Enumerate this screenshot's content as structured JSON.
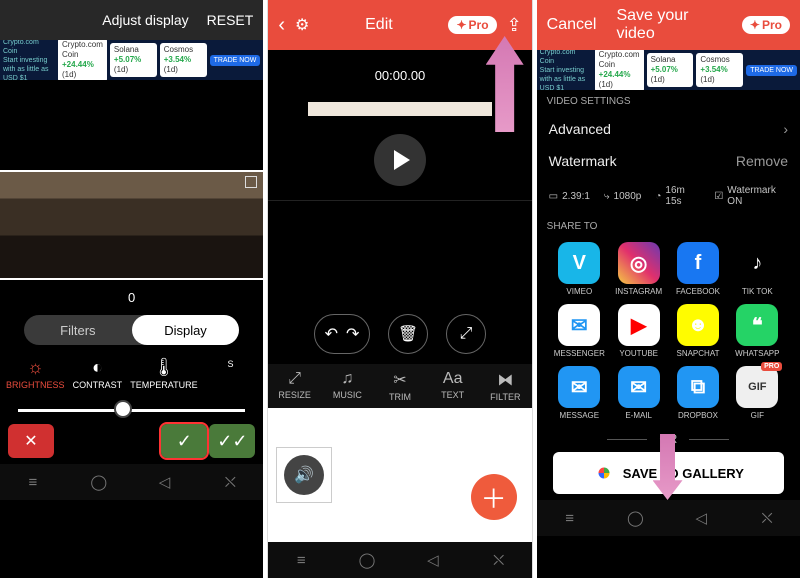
{
  "screen1": {
    "header": {
      "adjust": "Adjust display",
      "reset": "RESET"
    },
    "value": "0",
    "tabs": {
      "filters": "Filters",
      "display": "Display"
    },
    "adjustments": [
      {
        "name": "BRIGHTNESS",
        "icon": "☼"
      },
      {
        "name": "CONTRAST",
        "icon": "◐"
      },
      {
        "name": "TEMPERATURE",
        "icon": "🌡"
      },
      {
        "name": "S",
        "icon": ""
      }
    ]
  },
  "ad": {
    "tagline1": "Crypto.com Coin",
    "tagline2": "Start investing with as little as USD $1",
    "trade": "TRADE NOW",
    "cards": [
      {
        "name": "Crypto.com Coin",
        "pct": "+24.44%",
        "suffix": "(1d)"
      },
      {
        "name": "Solana",
        "pct": "+5.07%",
        "suffix": "(1d)"
      },
      {
        "name": "Cosmos",
        "pct": "+3.54%",
        "suffix": "(1d)"
      }
    ]
  },
  "screen2": {
    "title": "Edit",
    "pro": "Pro",
    "timestamp": "00:00.00",
    "tools": [
      {
        "name": "RESIZE",
        "icon": "⤢"
      },
      {
        "name": "MUSIC",
        "icon": "♫"
      },
      {
        "name": "TRIM",
        "icon": "✂"
      },
      {
        "name": "TEXT",
        "icon": "Aa"
      },
      {
        "name": "FILTER",
        "icon": "⧓"
      }
    ]
  },
  "screen3": {
    "cancel": "Cancel",
    "title": "Save your video",
    "pro": "Pro",
    "section_video": "VIDEO SETTINGS",
    "rows": {
      "advanced": "Advanced",
      "watermark": "Watermark",
      "remove": "Remove"
    },
    "info": {
      "ratio": "2.39:1",
      "res": "1080p",
      "dur": "16m 15s",
      "wm": "Watermark ON"
    },
    "section_share": "SHARE TO",
    "apps": [
      {
        "label": "VIMEO",
        "bg": "#18b6e8",
        "glyph": "V"
      },
      {
        "label": "INSTAGRAM",
        "bg": "linear-gradient(45deg,#f5c843,#e1306c,#6a3ab2)",
        "glyph": "◎"
      },
      {
        "label": "FACEBOOK",
        "bg": "#1877f2",
        "glyph": "f"
      },
      {
        "label": "TIK TOK",
        "bg": "#000",
        "glyph": "♪"
      },
      {
        "label": "MESSENGER",
        "bg": "#fff",
        "glyph": "✉",
        "fg": "#2196f3"
      },
      {
        "label": "YOUTUBE",
        "bg": "#fff",
        "glyph": "▶",
        "fg": "#f00"
      },
      {
        "label": "SNAPCHAT",
        "bg": "#fffc00",
        "glyph": "☻",
        "fg": "#fff"
      },
      {
        "label": "WHATSAPP",
        "bg": "#25d366",
        "glyph": "❝"
      },
      {
        "label": "MESSAGE",
        "bg": "#2196f3",
        "glyph": "✉"
      },
      {
        "label": "E-MAIL",
        "bg": "#2196f3",
        "glyph": "✉"
      },
      {
        "label": "DROPBOX",
        "bg": "#2196f3",
        "glyph": "⧉"
      },
      {
        "label": "GIF",
        "bg": "#efefef",
        "glyph": "GIF",
        "fg": "#333",
        "badge": "PRO"
      }
    ],
    "or": "OR",
    "save": "SAVE TO GALLERY"
  }
}
